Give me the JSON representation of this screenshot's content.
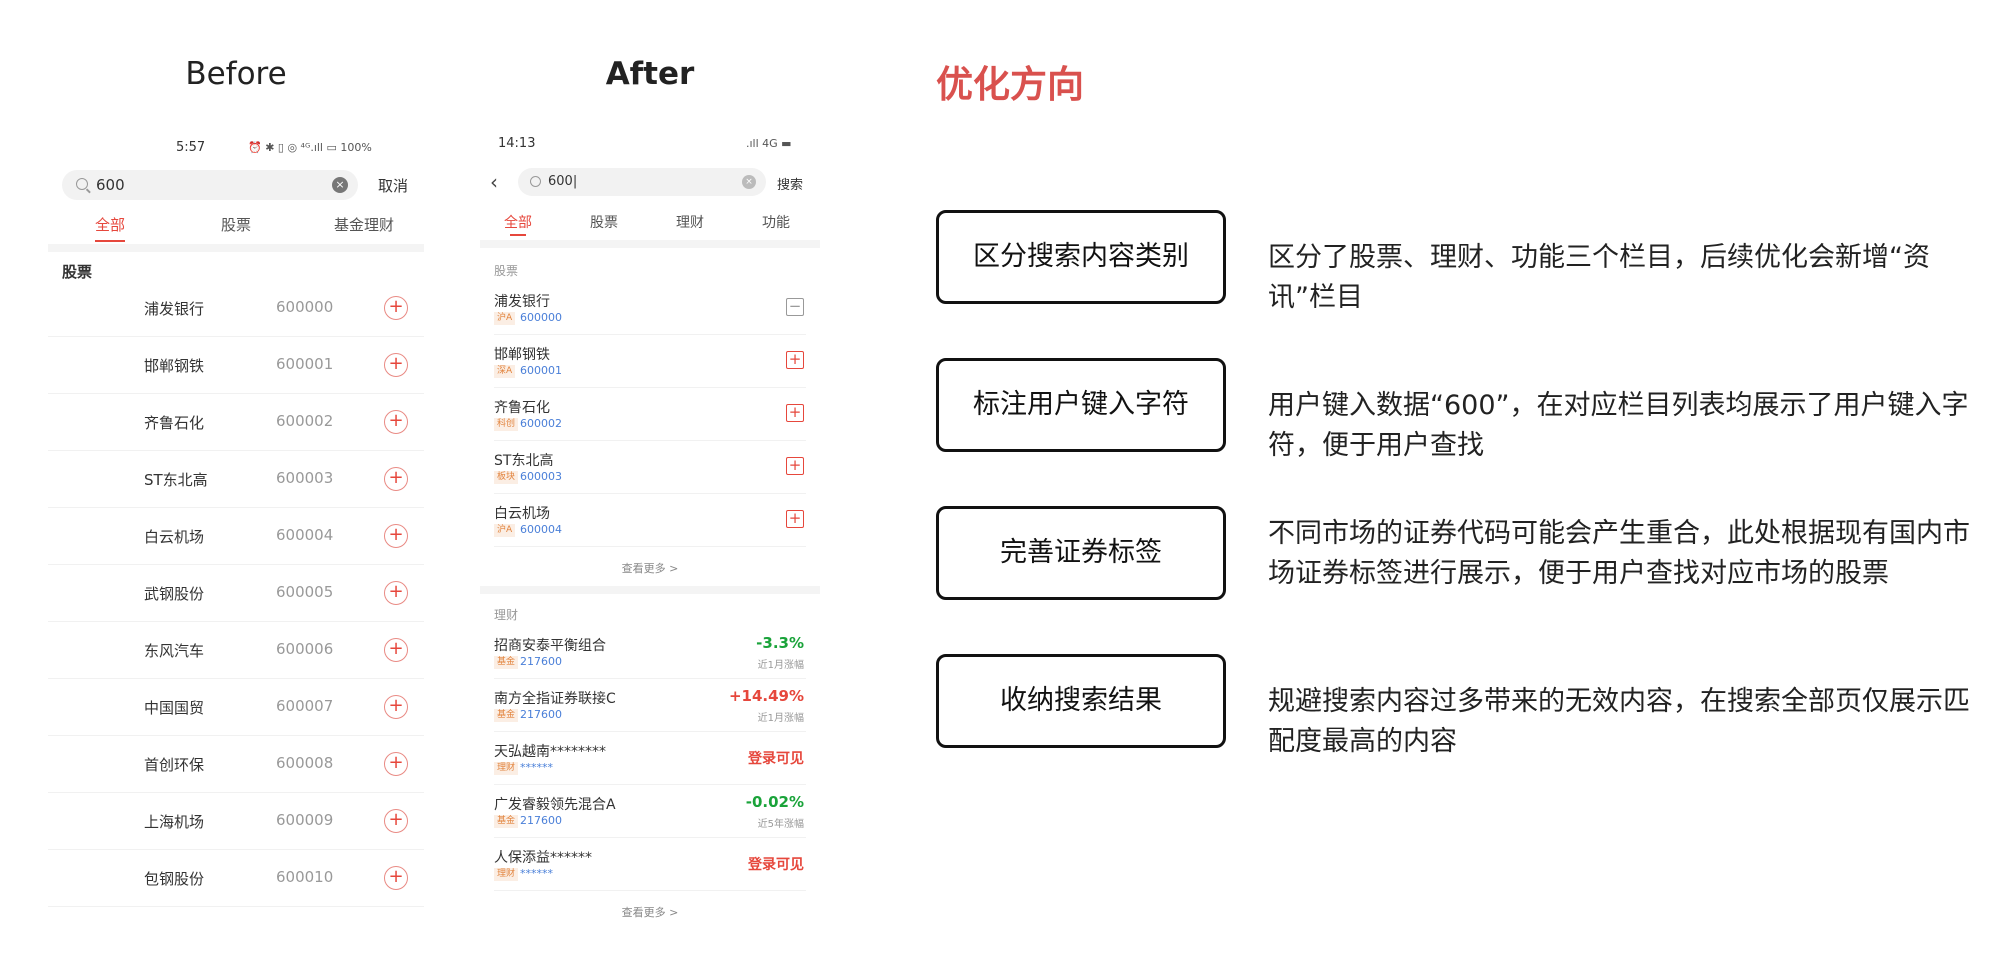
{
  "headings": {
    "before": "Before",
    "after": "After",
    "optimization": "优化方向"
  },
  "before": {
    "status": {
      "time": "5:57",
      "icons": "⏰ ✱ ▯ ◎ ⁴ᴳ.ıll ▭ 100%"
    },
    "search": {
      "value": "600",
      "clear": "×",
      "cancel": "取消"
    },
    "tabs": [
      "全部",
      "股票",
      "基金理财"
    ],
    "section": "股票",
    "rows": [
      {
        "name": "浦发银行",
        "code": "600000"
      },
      {
        "name": "邯郸钢铁",
        "code": "600001"
      },
      {
        "name": "齐鲁石化",
        "code": "600002"
      },
      {
        "name": "ST东北高",
        "code": "600003"
      },
      {
        "name": "白云机场",
        "code": "600004"
      },
      {
        "name": "武钢股份",
        "code": "600005"
      },
      {
        "name": "东风汽车",
        "code": "600006"
      },
      {
        "name": "中国国贸",
        "code": "600007"
      },
      {
        "name": "首创环保",
        "code": "600008"
      },
      {
        "name": "上海机场",
        "code": "600009"
      },
      {
        "name": "包钢股份",
        "code": "600010"
      }
    ],
    "add_symbol": "+"
  },
  "after": {
    "status": {
      "time": "14:13",
      "icons": ".ıll 4G ▬"
    },
    "back": "‹",
    "search": {
      "value": "600|",
      "clear": "×",
      "button": "搜索"
    },
    "tabs": [
      "全部",
      "股票",
      "理财",
      "功能"
    ],
    "stock_section": "股票",
    "stocks": [
      {
        "name": "浦发银行",
        "tag": "沪A",
        "code": "600000",
        "add": "−"
      },
      {
        "name": "邯郸钢铁",
        "tag": "深A",
        "code": "600001",
        "add": "+"
      },
      {
        "name": "齐鲁石化",
        "tag": "科创",
        "code": "600002",
        "add": "+"
      },
      {
        "name": "ST东北高",
        "tag": "板块",
        "code": "600003",
        "add": "+"
      },
      {
        "name": "白云机场",
        "tag": "沪A",
        "code": "600004",
        "add": "+"
      }
    ],
    "more": "查看更多 >",
    "fund_section": "理财",
    "funds": [
      {
        "name": "招商安泰平衡组合",
        "tag": "基金",
        "code": "217600",
        "value": "-3.3%",
        "sub": "近1月涨幅"
      },
      {
        "name": "南方全指证券联接C",
        "tag": "基金",
        "code": "217600",
        "value": "+14.49%",
        "sub": "近1月涨幅"
      },
      {
        "name": "天弘越南********",
        "tag": "理财",
        "code": "******",
        "value": "登录可见",
        "sub": ""
      },
      {
        "name": "广发睿毅领先混合A",
        "tag": "基金",
        "code": "217600",
        "value": "-0.02%",
        "sub": "近5年涨幅"
      },
      {
        "name": "人保添益******",
        "tag": "理财",
        "code": "******",
        "value": "登录可见",
        "sub": ""
      }
    ],
    "more2": "查看更多 >"
  },
  "optimizations": [
    {
      "title": "区分搜索内容类别",
      "desc": "区分了股票、理财、功能三个栏目，后续优化会新增“资讯”栏目"
    },
    {
      "title": "标注用户键入字符",
      "desc": "用户键入数据“600”，在对应栏目列表均展示了用户键入字符，便于用户查找"
    },
    {
      "title": "完善证券标签",
      "desc": "不同市场的证券代码可能会产生重合，此处根据现有国内市场证券标签进行展示，便于用户查找对应市场的股票"
    },
    {
      "title": "收纳搜索结果",
      "desc": "规避搜索内容过多带来的无效内容，在搜索全部页仅展示匹配度最高的内容"
    }
  ],
  "colors": {
    "accent": "#e6473c",
    "heading_red": "#d9514e",
    "up_red": "#e6473c",
    "down_green": "#1aa33a",
    "code_blue": "#4a7fd8"
  }
}
